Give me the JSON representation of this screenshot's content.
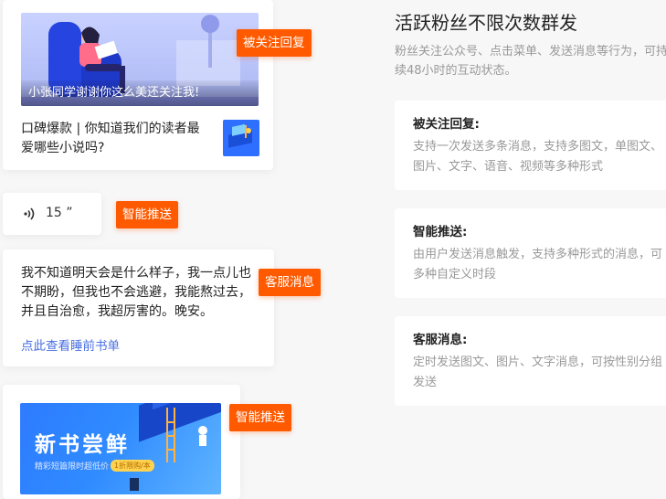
{
  "article_card": {
    "hero_caption": "小张同学谢谢你这么美还关注我!",
    "title": "口碑爆款 | 你知道我们的读者最爱哪些小说吗?",
    "tag": "被关注回复"
  },
  "voice_card": {
    "duration": "15 ”",
    "tag": "智能推送"
  },
  "text_card": {
    "message": "我不知道明天会是什么样子，我一点儿也不期盼，但我也不会逃避，我能熬过去，并且自治愈，我超厉害的。晚安。",
    "link": "点此查看睡前书单",
    "tag": "客服消息"
  },
  "book_card": {
    "title": "新书尝鲜",
    "subtitle": "精彩短篇限时超低价",
    "badge": "1折限购/本",
    "tag": "智能推送"
  },
  "right_panel": {
    "title": "活跃粉丝不限次数群发",
    "description": "粉丝关注公众号、点击菜单、发送消息等行为，可持续48小时的互动状态。",
    "features": [
      {
        "title": "被关注回复:",
        "desc": "支持一次发送多条消息，支持多图文，单图文、图片、文字、语音、视频等多种形式"
      },
      {
        "title": "智能推送:",
        "desc": "由用户发送消息触发，支持多种形式的消息，可多种自定义时段"
      },
      {
        "title": "客服消息:",
        "desc": "定时发送图文、图片、文字消息，可按性别分组发送"
      }
    ]
  },
  "colors": {
    "accent": "#ff5a00",
    "link": "#4a6fe0",
    "banner_blue": "#2e7bff"
  }
}
